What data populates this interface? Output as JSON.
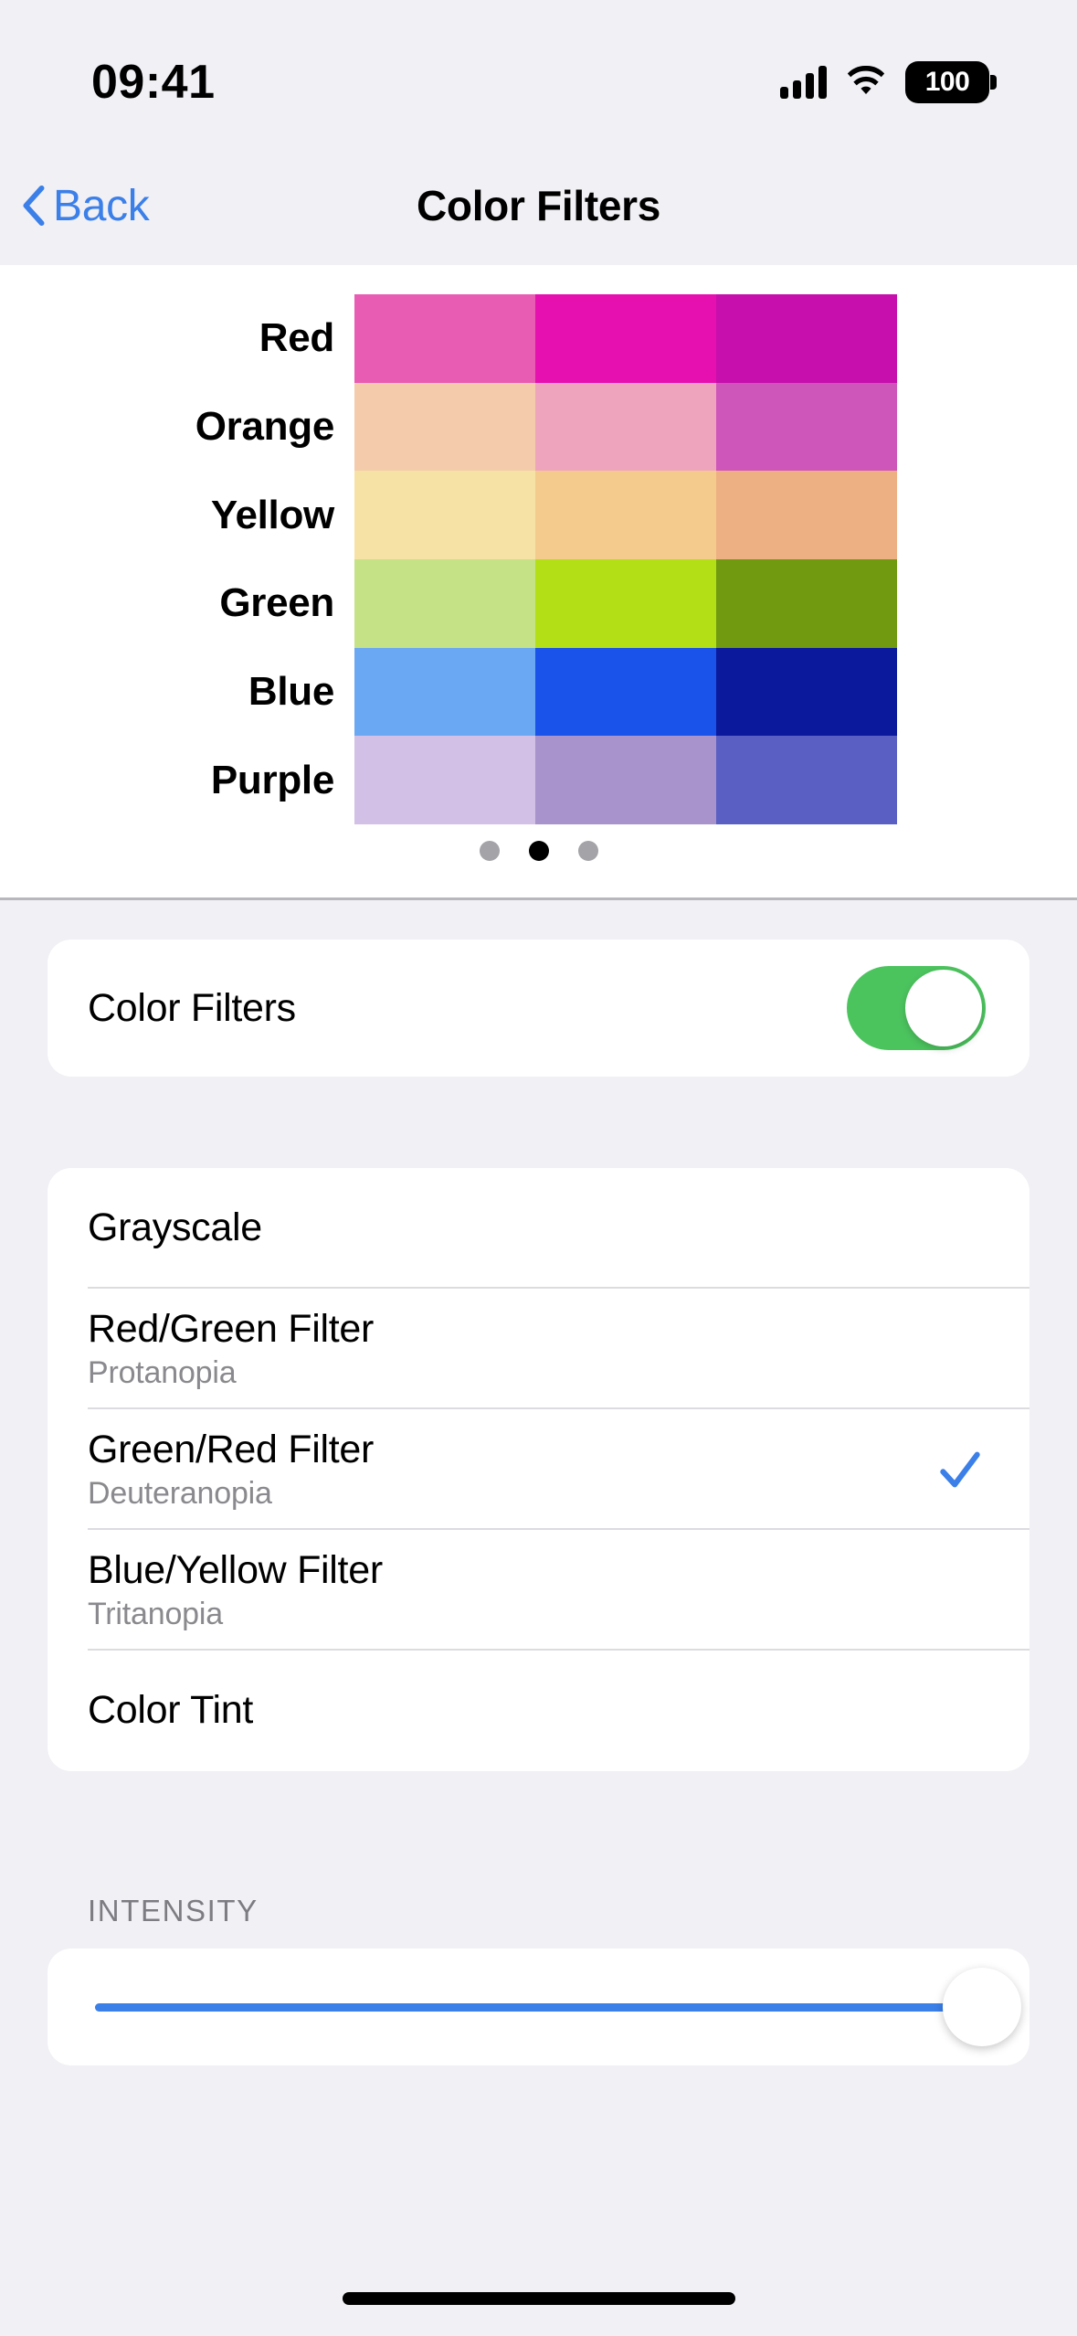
{
  "status_bar": {
    "time": "09:41",
    "battery_level": "100",
    "signal_icon": "signal-bars-icon",
    "wifi_icon": "wifi-icon",
    "battery_icon": "battery-icon"
  },
  "nav": {
    "back_label": "Back",
    "back_icon": "chevron-left-icon",
    "title": "Color Filters"
  },
  "preview": {
    "row_labels": [
      "Red",
      "Orange",
      "Yellow",
      "Green",
      "Blue",
      "Purple"
    ],
    "swatches": [
      [
        "#E95CB4",
        "#E610B0",
        "#C60FAC"
      ],
      [
        "#F4CCAB",
        "#EFA4BE",
        "#CE55B9"
      ],
      [
        "#F7E2A5",
        "#F5CA8D",
        "#EDB083"
      ],
      [
        "#C5E287",
        "#B3DF16",
        "#719A10"
      ],
      [
        "#6BA8F4",
        "#1A53E9",
        "#0B1A9D"
      ],
      [
        "#D3C0E6",
        "#A893CC",
        "#5A60C3"
      ]
    ],
    "page_dots": {
      "count": 3,
      "active_index": 1
    }
  },
  "toggle_section": {
    "label": "Color Filters",
    "enabled": true,
    "on_color": "#4CC45E"
  },
  "filters": [
    {
      "name": "Grayscale",
      "subtitle": "",
      "selected": false
    },
    {
      "name": "Red/Green Filter",
      "subtitle": "Protanopia",
      "selected": false
    },
    {
      "name": "Green/Red Filter",
      "subtitle": "Deuteranopia",
      "selected": true
    },
    {
      "name": "Blue/Yellow Filter",
      "subtitle": "Tritanopia",
      "selected": false
    },
    {
      "name": "Color Tint",
      "subtitle": "",
      "selected": false
    }
  ],
  "intensity": {
    "header": "INTENSITY",
    "value_percent": 100,
    "fill_color": "#3B7FE8"
  },
  "accent_color": "#3B7FE8",
  "home_indicator": "home-indicator"
}
